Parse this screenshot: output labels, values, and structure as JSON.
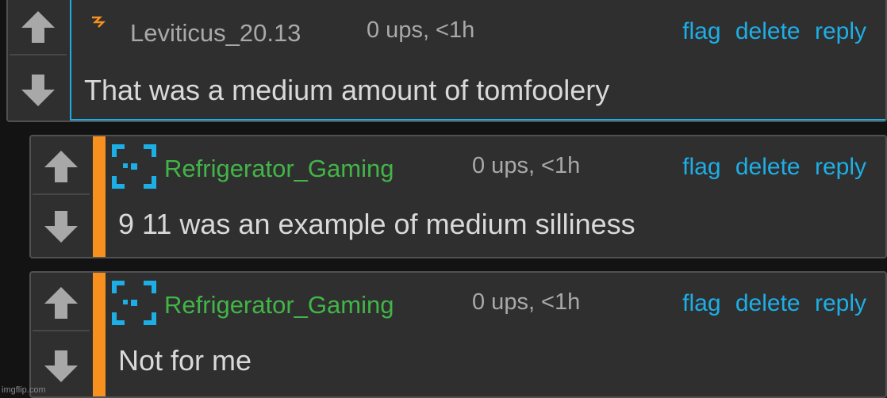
{
  "colors": {
    "link": "#1eaee6",
    "username_green": "#42b548",
    "username_grey": "#a9a9a9",
    "highlight_orange": "#f7901e"
  },
  "comments": [
    {
      "username": "Leviticus_20.13",
      "meta": "0 ups, <1h",
      "actions": {
        "flag": "flag",
        "delete": "delete",
        "reply": "reply"
      },
      "text": "That was a medium amount of tomfoolery",
      "icon": "lightning-icon"
    },
    {
      "username": "Refrigerator_Gaming",
      "meta": "0 ups, <1h",
      "actions": {
        "flag": "flag",
        "delete": "delete",
        "reply": "reply"
      },
      "text": "9 11 was an example of medium silliness",
      "icon": "pixel-square-icon"
    },
    {
      "username": "Refrigerator_Gaming",
      "meta": "0 ups, <1h",
      "actions": {
        "flag": "flag",
        "delete": "delete",
        "reply": "reply"
      },
      "text": "Not for me",
      "icon": "pixel-square-icon"
    }
  ],
  "watermark": "imgflip.com"
}
